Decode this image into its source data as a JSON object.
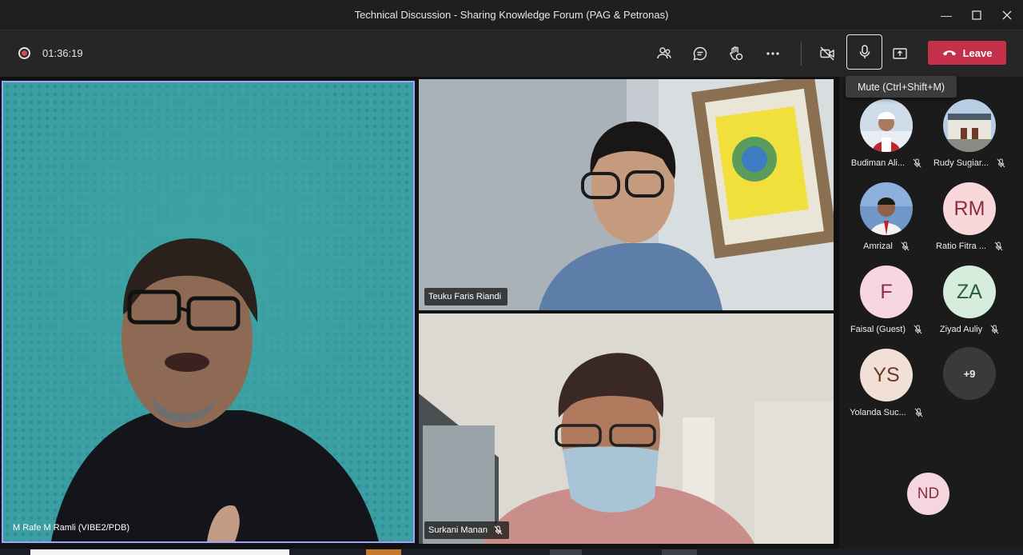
{
  "window": {
    "title": "Technical Discussion - Sharing Knowledge Forum (PAG & Petronas)",
    "minimize_icon": "minimize-icon",
    "maximize_icon": "maximize-icon",
    "close_icon": "close-icon"
  },
  "toolbar": {
    "recording_icon": "recording-icon",
    "duration": "01:36:19",
    "buttons": [
      "people-icon",
      "chat-icon",
      "raise-hand-icon",
      "more-icon",
      "camera-off-icon",
      "microphone-icon",
      "share-icon"
    ],
    "leave_label": "Leave",
    "leave_color": "#c4314b"
  },
  "tooltip": {
    "text": "Mute (Ctrl+Shift+M)"
  },
  "stage": {
    "main_speaker": {
      "name": "M Rafe M Ramli (VIBE2/PDB)"
    },
    "top_right": {
      "name": "Teuku Faris Riandi"
    },
    "bottom_right": {
      "name": "Surkani Manan",
      "muted": true
    }
  },
  "participants": [
    {
      "name": "Budiman Ali...",
      "type": "photo",
      "muted": true
    },
    {
      "name": "Rudy Sugiar...",
      "type": "photo",
      "muted": true
    },
    {
      "name": "Amrizal",
      "type": "photo",
      "muted": true
    },
    {
      "name": "Ratio Fitra ...",
      "initials": "RM",
      "bg": "#f8d8da",
      "fg": "#8d2b45",
      "muted": true
    },
    {
      "name": "Faisal (Guest)",
      "initials": "F",
      "bg": "#f7d5e3",
      "fg": "#8d2b45",
      "muted": true
    },
    {
      "name": "Ziyad Auliy",
      "initials": "ZA",
      "bg": "#d6ecdd",
      "fg": "#2f5d3a",
      "muted": true
    },
    {
      "name": "Yolanda Suc...",
      "initials": "YS",
      "bg": "#f2dfd6",
      "fg": "#6b3b2a",
      "muted": true
    }
  ],
  "overflow": {
    "label": "+9"
  },
  "self_view": {
    "initials": "ND"
  },
  "accent": "#9ea2ff"
}
